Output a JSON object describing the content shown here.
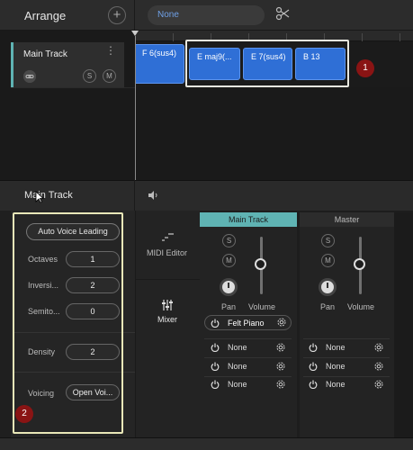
{
  "header": {
    "title": "Arrange",
    "add_label": "+",
    "chord_set_value": "None"
  },
  "track": {
    "name": "Main Track",
    "solo": "S",
    "mute": "M"
  },
  "chords": [
    {
      "label": "F 6(sus4)"
    },
    {
      "label": "E maj9(..."
    },
    {
      "label": "E 7(sus4)"
    },
    {
      "label": "B 13"
    }
  ],
  "badges": {
    "one": "1",
    "two": "2"
  },
  "panel": {
    "title": "Main Track"
  },
  "inspector": {
    "auto_voice_leading": "Auto Voice Leading",
    "octaves_label": "Octaves",
    "octaves_value": "1",
    "inversions_label": "Inversi...",
    "inversions_value": "2",
    "semitones_label": "Semito...",
    "semitones_value": "0",
    "density_label": "Density",
    "density_value": "2",
    "voicing_label": "Voicing",
    "voicing_value": "Open Voi..."
  },
  "side_nav": {
    "midi_editor": "MIDI Editor",
    "mixer": "Mixer"
  },
  "channels": {
    "main": {
      "name": "Main Track",
      "solo": "S",
      "mute": "M",
      "pan_label": "Pan",
      "volume_label": "Volume",
      "instrument": "Felt Piano",
      "slots": [
        "None",
        "None",
        "None"
      ]
    },
    "master": {
      "name": "Master",
      "solo": "S",
      "mute": "M",
      "pan_label": "Pan",
      "volume_label": "Volume",
      "slots": [
        "None",
        "None",
        "None"
      ]
    }
  },
  "colors": {
    "track_accent": "#5fb3b3",
    "chord_blue": "#2f6fd6",
    "badge_red": "#8a1414",
    "highlight_yellow": "#e9e7b8"
  }
}
